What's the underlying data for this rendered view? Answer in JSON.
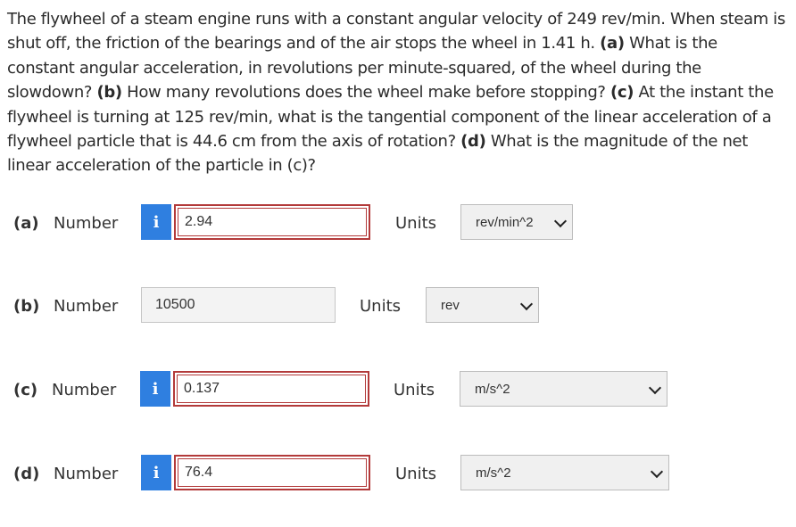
{
  "problem": {
    "p1": "The flywheel of a steam engine runs with a constant angular velocity of 249 rev/min. When steam is shut off, the friction of the bearings and of the air stops the wheel in 1.41 h. ",
    "a_tag": "(a)",
    "a_text": " What is the constant angular acceleration, in revolutions per minute-squared, of the wheel during the slowdown? ",
    "b_tag": "(b)",
    "b_text": " How many revolutions does the wheel make before stopping? ",
    "c_tag": "(c)",
    "c_text": " At the instant the flywheel is turning at 125 rev/min, what is the tangential component of the linear acceleration of a flywheel particle that is 44.6 cm from the axis of rotation? ",
    "d_tag": "(d)",
    "d_text": " What is the magnitude of the net linear acceleration of the particle in (c)?"
  },
  "number_label": "Number",
  "units_label": "Units",
  "info_glyph": "i",
  "answers": [
    {
      "part": "(a)",
      "value": "2.94",
      "unit": "rev/min^2"
    },
    {
      "part": "(b)",
      "value": "10500",
      "unit": "rev"
    },
    {
      "part": "(c)",
      "value": "0.137",
      "unit": "m/s^2"
    },
    {
      "part": "(d)",
      "value": "76.4",
      "unit": "m/s^2"
    }
  ]
}
